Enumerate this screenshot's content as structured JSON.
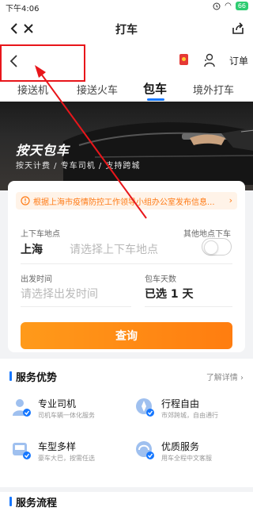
{
  "status": {
    "time": "下午4:06",
    "battery": "66"
  },
  "titlebar": {
    "title": "打车"
  },
  "innernav": {
    "orders": "订单"
  },
  "tabs": [
    {
      "label": "接送机"
    },
    {
      "label": "接送火车"
    },
    {
      "label": "包车"
    },
    {
      "label": "境外打车"
    }
  ],
  "banner": {
    "title": "按天包车",
    "subtitle": "按天计费 / 专车司机 / 支持跨城"
  },
  "card": {
    "notice": "根据上海市疫情防控工作领导小组办公室发布信息...",
    "pickup_label": "上下车地点",
    "city": "上海",
    "address_placeholder": "请选择上下车地点",
    "other_label": "其他地点下车",
    "time_label": "出发时间",
    "time_placeholder": "请选择出发时间",
    "days_label": "包车天数",
    "days_value": "已选 1 天",
    "search_label": "查询"
  },
  "advantages": {
    "title": "服务优势",
    "more": "了解详情 ›",
    "items": [
      {
        "title": "专业司机",
        "desc": "司机车辆一体化服务",
        "icon": "driver-icon"
      },
      {
        "title": "行程自由",
        "desc": "市郊跨城，自由通行",
        "icon": "compass-icon"
      },
      {
        "title": "车型多样",
        "desc": "豪车大巴，按需任选",
        "icon": "bus-icon"
      },
      {
        "title": "优质服务",
        "desc": "用车全程中文客服",
        "icon": "headset-icon"
      }
    ]
  },
  "process": {
    "title": "服务流程"
  }
}
